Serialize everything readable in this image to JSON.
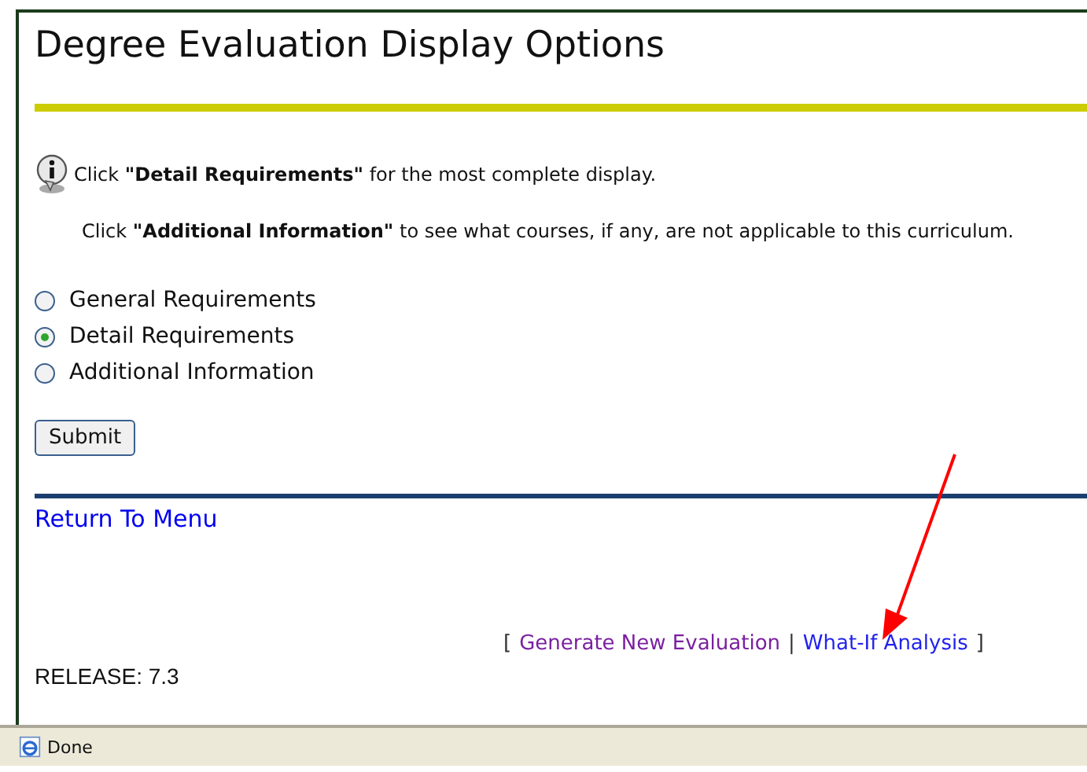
{
  "page": {
    "title": "Degree Evaluation Display Options"
  },
  "notes": [
    {
      "kind": "info",
      "text": "Click **\"Detail Requirements\"** for the most complete display."
    },
    {
      "kind": "plain",
      "text": "Click **\"Additional Information\"** to see what courses, if any, are not applicable to this curriculum."
    }
  ],
  "options": [
    {
      "label": "General Requirements",
      "selected": false
    },
    {
      "label": "Detail Requirements",
      "selected": true
    },
    {
      "label": "Additional Information",
      "selected": false
    }
  ],
  "submit_button": "Submit",
  "return_link": "Return To Menu",
  "footer_links": {
    "open": "[",
    "separator": "|",
    "close": "]",
    "links": [
      {
        "label": "Generate New Evaluation",
        "visited": true
      },
      {
        "label": "What-If Analysis",
        "visited": false
      }
    ]
  },
  "release": "RELEASE: 7.3",
  "status_bar": {
    "text": "Done"
  }
}
